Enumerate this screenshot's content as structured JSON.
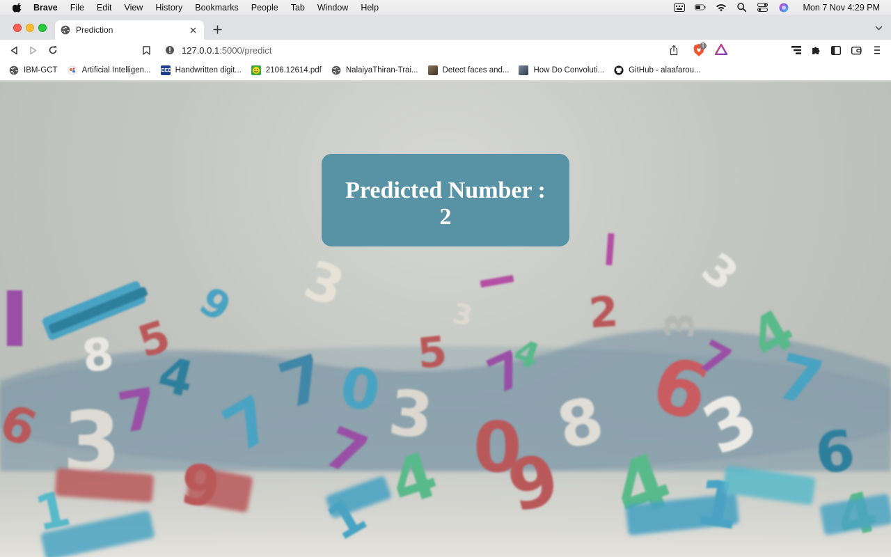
{
  "menubar": {
    "app": "Brave",
    "items": [
      "File",
      "Edit",
      "View",
      "History",
      "Bookmarks",
      "People",
      "Tab",
      "Window",
      "Help"
    ],
    "clock": "Mon 7 Nov  4:29 PM"
  },
  "tab": {
    "title": "Prediction"
  },
  "omnibox": {
    "host": "127.0.0.1",
    "path": ":5000/predict",
    "shields_count": "1"
  },
  "bookmarks": [
    {
      "label": "IBM-GCT",
      "icon": "globe-icon",
      "color": "#555555"
    },
    {
      "label": "Artificial Intelligen...",
      "icon": "ai-icon",
      "color": "#e0703a"
    },
    {
      "label": "Handwritten digit...",
      "icon": "ieee-icon",
      "color": "#1f3f8f"
    },
    {
      "label": "2106.12614.pdf",
      "icon": "smiley-icon",
      "color": "#3aa83a"
    },
    {
      "label": "NalaiyaThiran-Trai...",
      "icon": "globe-icon",
      "color": "#555555"
    },
    {
      "label": "Detect faces and...",
      "icon": "thumbnail-icon",
      "color": "#6b5a45"
    },
    {
      "label": "How Do Convoluti...",
      "icon": "thumbnail-icon",
      "color": "#4a5a70"
    },
    {
      "label": "GitHub - alaafarou...",
      "icon": "github-icon",
      "color": "#1b1b1b"
    }
  ],
  "result": {
    "label": "Predicted Number :",
    "value": "2"
  },
  "colors": {
    "card": "#5793a4",
    "digit_teal": "#4aa3c2",
    "digit_red": "#b9585a",
    "digit_purple": "#9a4fa6",
    "digit_green": "#58b98a",
    "digit_white": "#e9e7e2"
  }
}
